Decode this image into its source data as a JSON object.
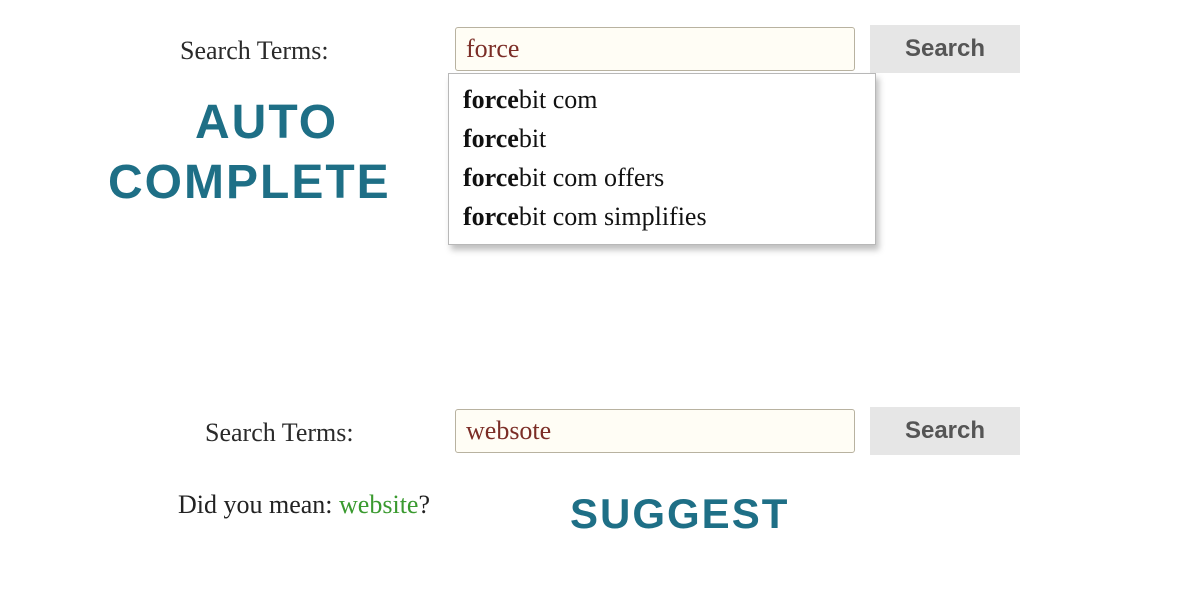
{
  "top": {
    "label": "Search Terms:",
    "input_value": "force",
    "button": "Search",
    "suggestions": [
      {
        "match": "force",
        "rest": "bit com"
      },
      {
        "match": "force",
        "rest": "bit"
      },
      {
        "match": "force",
        "rest": "bit com offers"
      },
      {
        "match": "force",
        "rest": "bit com simplifies"
      }
    ]
  },
  "bottom": {
    "label": "Search Terms:",
    "input_value": "websote",
    "button": "Search",
    "did_you_mean_prefix": "Did you mean: ",
    "did_you_mean_term": "website",
    "did_you_mean_suffix": "?"
  },
  "callouts": {
    "auto": "Auto",
    "complete": "Complete",
    "suggest": "Suggest"
  },
  "colors": {
    "accent_text": "#1e6f86",
    "input_text": "#7b2d26",
    "link_green": "#3a9a2f",
    "button_bg": "#e6e6e6"
  }
}
